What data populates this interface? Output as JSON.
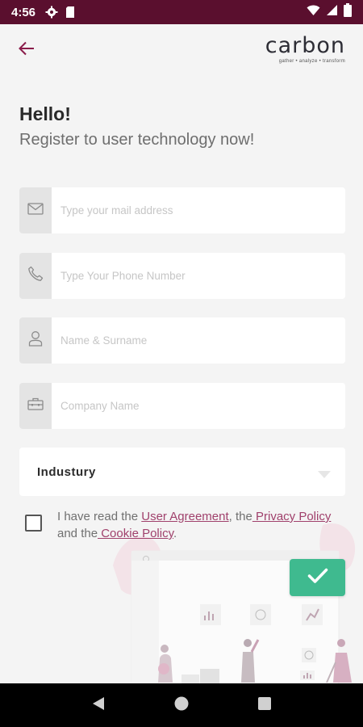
{
  "status_bar": {
    "time": "4:56",
    "icons": [
      "gear-icon",
      "sd-card-icon",
      "wifi-icon",
      "signal-icon",
      "battery-icon"
    ],
    "background": "#5a0f2e"
  },
  "app_bar": {
    "back_icon": "arrow-left-icon",
    "logo_text": "carbon",
    "logo_tagline": "gather • analyze • transform"
  },
  "header": {
    "title": "Hello!",
    "subtitle": "Register to user technology now!"
  },
  "form": {
    "email": {
      "icon": "mail-icon",
      "placeholder": "Type your mail address",
      "value": ""
    },
    "phone": {
      "icon": "phone-icon",
      "placeholder": "Type Your Phone Number",
      "value": ""
    },
    "name": {
      "icon": "user-icon",
      "placeholder": "Name & Surname",
      "value": ""
    },
    "company": {
      "icon": "briefcase-icon",
      "placeholder": "Company Name",
      "value": ""
    },
    "industry": {
      "label": "Industury",
      "icon": "caret-down-icon"
    }
  },
  "agreement": {
    "checked": false,
    "text_1": "I have read the",
    "user_agreement": "User Agreement",
    "text_2": ", the",
    "privacy_policy": " Privacy Policy",
    "text_3": " and the",
    "cookie_policy": " Cookie Policy",
    "text_4": "."
  },
  "submit": {
    "icon": "check-icon",
    "color": "#3fba8f"
  },
  "colors": {
    "accent": "#8a1c4a",
    "link": "#a0416c",
    "submit": "#3fba8f"
  },
  "nav_bar": {
    "icons": [
      "back-triangle-icon",
      "home-circle-icon",
      "recents-square-icon"
    ]
  }
}
